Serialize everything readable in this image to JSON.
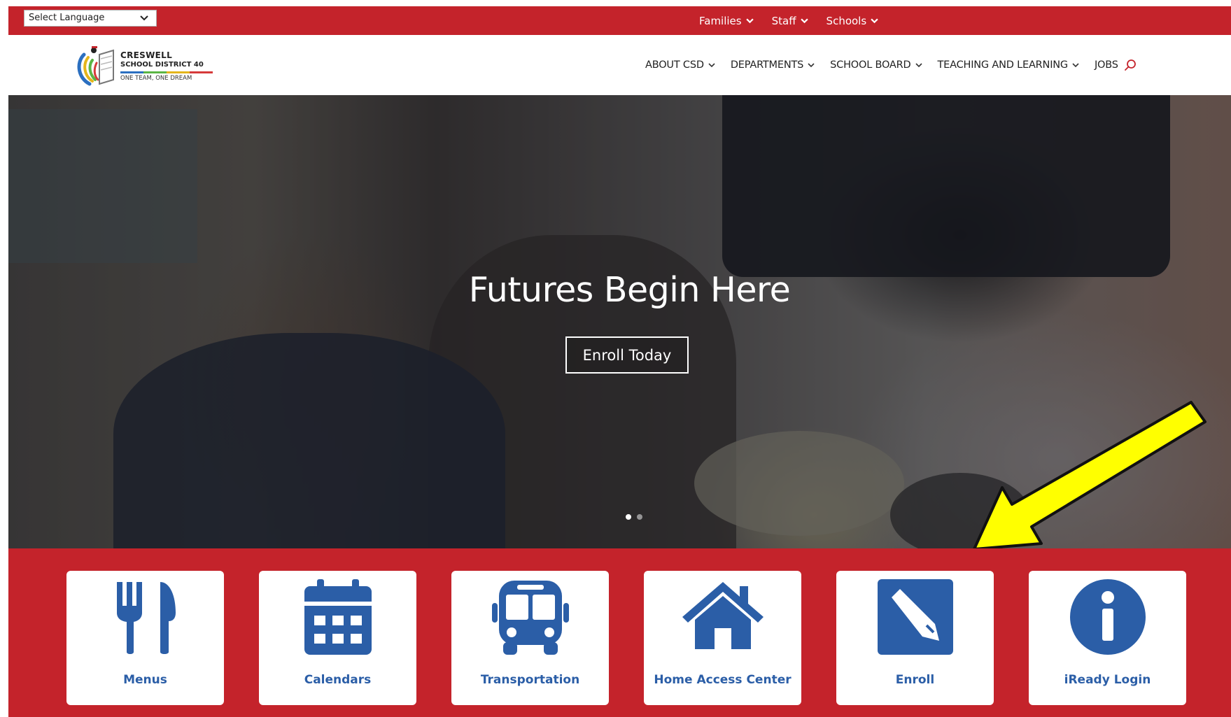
{
  "colors": {
    "brand_red": "#c4232b",
    "icon_blue": "#2b5ea7",
    "annotation_yellow": "#ffff00"
  },
  "topbar": {
    "language_select": "Select Language",
    "items": [
      {
        "label": "Families"
      },
      {
        "label": "Staff"
      },
      {
        "label": "Schools"
      }
    ]
  },
  "logo": {
    "line1": "CRESWELL",
    "line2": "SCHOOL DISTRICT 40",
    "line3": "ONE TEAM, ONE DREAM"
  },
  "nav": {
    "items": [
      {
        "label": "ABOUT CSD"
      },
      {
        "label": "DEPARTMENTS"
      },
      {
        "label": "SCHOOL BOARD"
      },
      {
        "label": "TEACHING AND LEARNING"
      },
      {
        "label": "JOBS"
      }
    ]
  },
  "hero": {
    "title": "Futures Begin Here",
    "button_label": "Enroll Today"
  },
  "quick_links": [
    {
      "label": "Menus",
      "icon": "utensils-icon"
    },
    {
      "label": "Calendars",
      "icon": "calendar-icon"
    },
    {
      "label": "Transportation",
      "icon": "bus-icon"
    },
    {
      "label": "Home Access Center",
      "icon": "home-icon"
    },
    {
      "label": "Enroll",
      "icon": "edit-icon"
    },
    {
      "label": "iReady Login",
      "icon": "info-icon"
    }
  ]
}
